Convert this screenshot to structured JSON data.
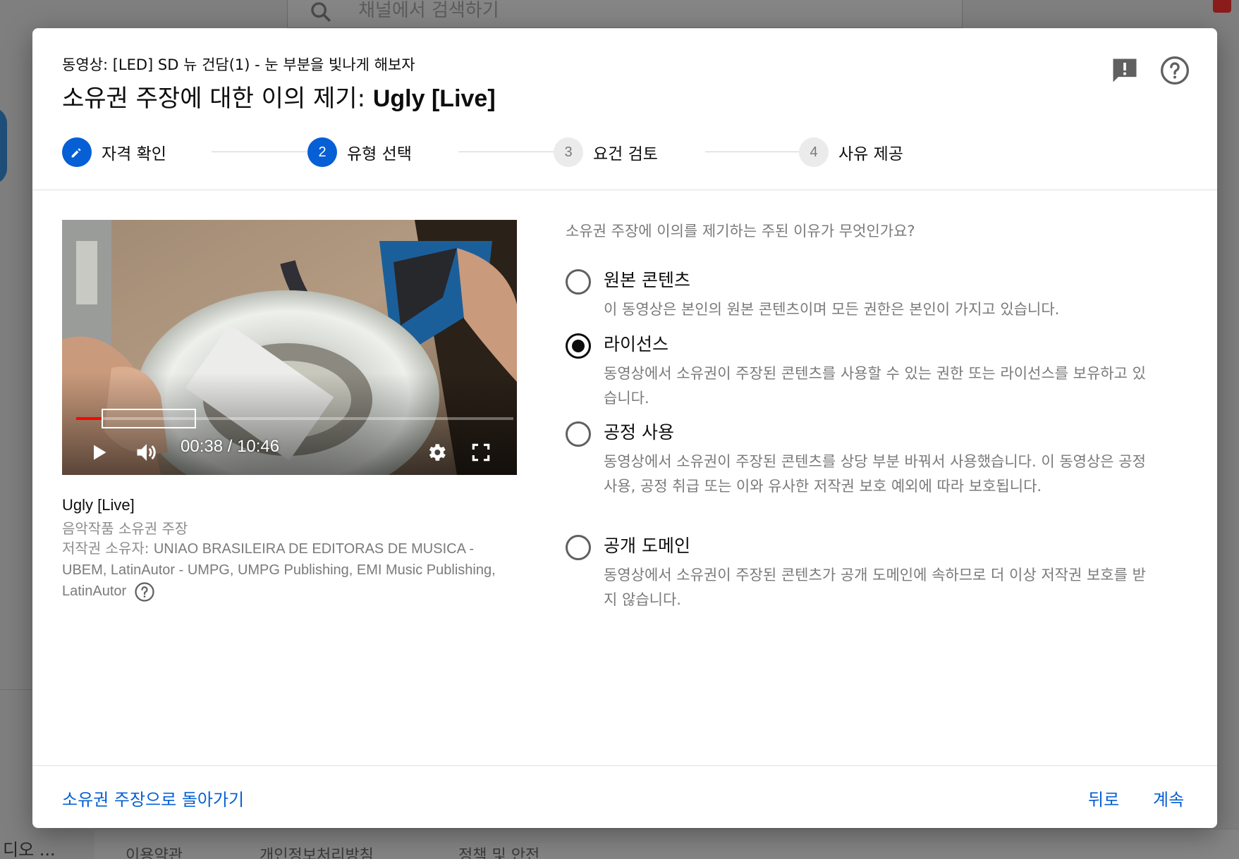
{
  "background": {
    "search_placeholder": "채널에서 검색하기",
    "side_label": "디오 ...",
    "footer_links": [
      "이용약관",
      "개인정보처리방침",
      "정책 및 안전"
    ]
  },
  "dialog": {
    "video_subtitle": "동영상: [LED] SD 뉴 건담(1) - 눈 부분을 빛나게 해보자",
    "title_prefix": "소유권 주장에 대한 이의 제기: ",
    "title_claim": "Ugly [Live]",
    "header_icons": [
      "feedback-icon",
      "help-icon"
    ],
    "steps": [
      {
        "marker": "✎",
        "label": "자격 확인",
        "state": "completed"
      },
      {
        "marker": "2",
        "label": "유형 선택",
        "state": "active"
      },
      {
        "marker": "3",
        "label": "요건 검토",
        "state": "inactive"
      },
      {
        "marker": "4",
        "label": "사유 제공",
        "state": "inactive"
      }
    ]
  },
  "player": {
    "time": "00:38 / 10:46",
    "progress_fraction": 0.059,
    "controls": [
      "play-icon",
      "volume-icon",
      "settings-icon",
      "fullscreen-icon"
    ]
  },
  "claim": {
    "title": "Ugly [Live]",
    "type": "음악작품 소유권 주장",
    "owner_prefix": "저작권 소유자: ",
    "owner_names": "UNIAO BRASILEIRA DE EDITORAS DE MUSICA - UBEM, LatinAutor - UMPG, UMPG Publishing, EMI Music Publishing, LatinAutor"
  },
  "form": {
    "question": "소유권 주장에 이의를 제기하는 주된 이유가 무엇인가요?",
    "options": [
      {
        "label": "원본 콘텐츠",
        "description": "이 동영상은 본인의 원본 콘텐츠이며 모든 권한은 본인이 가지고 있습니다.",
        "selected": false
      },
      {
        "label": "라이선스",
        "description": "동영상에서 소유권이 주장된 콘텐츠를 사용할 수 있는 권한 또는 라이선스를 보유하고 있습니다.",
        "selected": true
      },
      {
        "label": "공정 사용",
        "description": "동영상에서 소유권이 주장된 콘텐츠를 상당 부분 바꿔서 사용했습니다. 이 동영상은 공정 사용, 공정 취급 또는 이와 유사한 저작권 보호 예외에 따라 보호됩니다.",
        "selected": false
      },
      {
        "label": "공개 도메인",
        "description": "동영상에서 소유권이 주장된 콘텐츠가 공개 도메인에 속하므로 더 이상 저작권 보호를 받지 않습니다.",
        "selected": false
      }
    ]
  },
  "footer": {
    "back_to_claim": "소유권 주장으로 돌아가기",
    "back": "뒤로",
    "continue": "계속"
  },
  "colors": {
    "accent": "#065fd4",
    "progress_red": "#ff0000",
    "scrim": "#7f7f7f"
  }
}
